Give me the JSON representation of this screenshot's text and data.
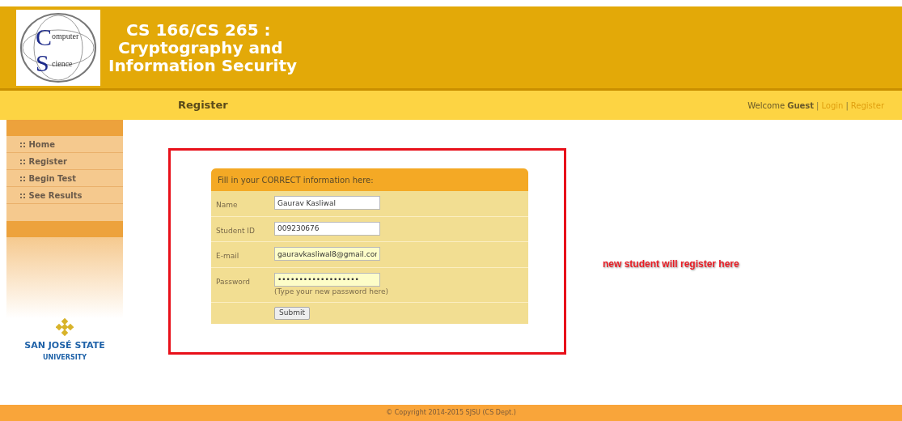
{
  "logo": {
    "letters": [
      "C",
      "S"
    ],
    "words": [
      "omputer",
      "cience"
    ]
  },
  "title_lines": [
    "CS 166/CS 265 :",
    "Cryptography and",
    "Information Security"
  ],
  "nav": {
    "page_title": "Register",
    "welcome": "Welcome",
    "user": "Guest",
    "separator": "|",
    "links": [
      "Login",
      "Register"
    ]
  },
  "sidebar": {
    "items": [
      ":: Home",
      ":: Register",
      ":: Begin Test",
      ":: See Results"
    ],
    "university": {
      "name": "SAN JOSÉ STATE",
      "sub": "UNIVERSITY"
    }
  },
  "form": {
    "heading": "Fill in your CORRECT information here:",
    "fields": [
      {
        "label": "Name",
        "value": "Gaurav Kasliwal",
        "highlighted": false
      },
      {
        "label": "Student ID",
        "value": "009230676",
        "highlighted": false
      },
      {
        "label": "E-mail",
        "value": "gauravkasliwal8@gmail.cor",
        "highlighted": true
      },
      {
        "label": "Password",
        "value": "•••••••••••••••••••",
        "highlighted": true,
        "hint": "(Type your new password here)"
      }
    ],
    "submit": "Submit"
  },
  "annotation": "new student will register here",
  "footer": "© Copyright 2014-2015 SJSU (CS Dept.)"
}
